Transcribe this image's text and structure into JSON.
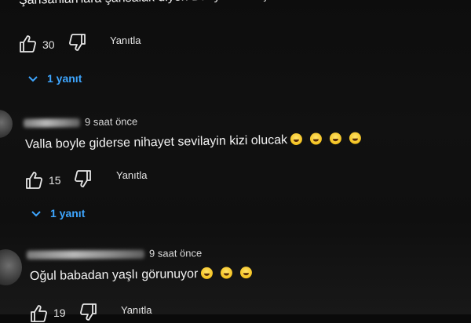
{
  "comments": [
    {
      "text": "Şansanlan'lara şansalak diyen Bünyamin'e Şansalak olma şerif",
      "likes": "30",
      "reply_label": "Yanıtla",
      "replies_label": "1 yanıt"
    },
    {
      "time": "9 saat önce",
      "text": "Valla boyle giderse nihayet sevilayin kizi olucak",
      "likes": "15",
      "reply_label": "Yanıtla",
      "replies_label": "1 yanıt"
    },
    {
      "time": "9 saat önce",
      "text": "Oğul babadan yaşlı görunuyor",
      "likes": "19",
      "reply_label": "Yanıtla"
    }
  ],
  "icons": {
    "like": "thumbs-up-icon",
    "dislike": "thumbs-down-icon",
    "expand": "chevron-down-icon",
    "emoji": "laughing-emoji-icon"
  },
  "colors": {
    "background": "#0a0a0a",
    "text": "#f2f2f2",
    "link_blue": "#3ea6ff"
  }
}
